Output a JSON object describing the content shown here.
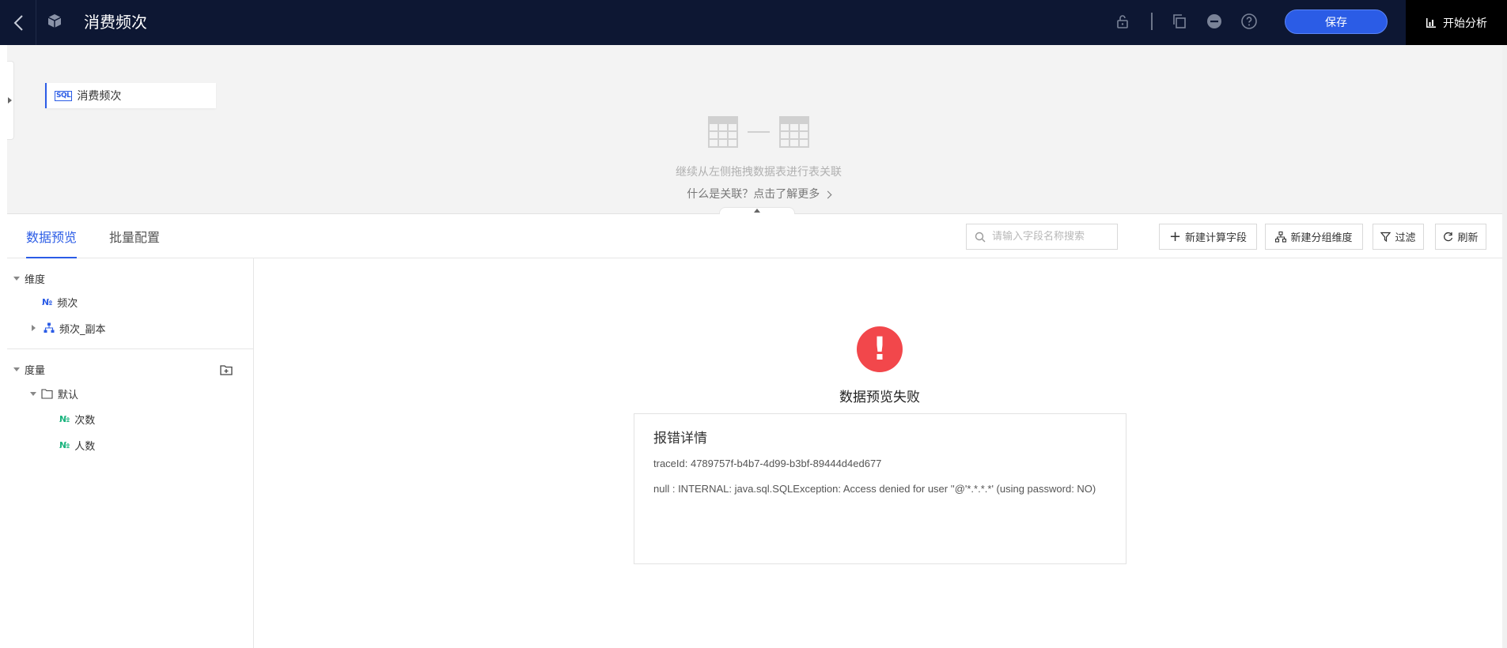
{
  "header": {
    "title": "消费频次",
    "save_label": "保存",
    "start_label": "开始分析",
    "icons": [
      "back-icon",
      "cube-icon",
      "lock-icon",
      "copy-icon",
      "minus-circle-icon",
      "help-icon",
      "chart-icon"
    ]
  },
  "canvas": {
    "table_node": {
      "badge": "SQL",
      "label": "消费频次"
    },
    "join_hint": "继续从左侧拖拽数据表进行表关联",
    "join_more": "什么是关联？点击了解更多"
  },
  "toolbar": {
    "tabs": [
      {
        "label": "数据预览",
        "active": true
      },
      {
        "label": "批量配置",
        "active": false
      }
    ],
    "search_placeholder": "请输入字段名称搜索",
    "buttons": {
      "new_calc": "新建计算字段",
      "new_group": "新建分组维度",
      "filter": "过滤",
      "refresh": "刷新"
    }
  },
  "tree": {
    "dimensions": {
      "label": "维度",
      "items": [
        {
          "icon": "№",
          "label": "频次"
        },
        {
          "icon": "hierarchy",
          "label": "频次_副本"
        }
      ]
    },
    "measures": {
      "label": "度量",
      "folder": "默认",
      "items": [
        {
          "icon": "№",
          "label": "次数"
        },
        {
          "icon": "№",
          "label": "人数"
        }
      ]
    }
  },
  "error": {
    "icon_text": "!",
    "title": "数据预览失败",
    "card_title": "报错详情",
    "trace": "traceId: 4789757f-b4b7-4d99-b3bf-89444d4ed677",
    "message": "null : INTERNAL: java.sql.SQLException: Access denied for user ''@'*.*.*.*' (using password: NO)"
  },
  "colors": {
    "header_bg": "#0d1733",
    "accent": "#2b5ce6",
    "error_red": "#f2474b",
    "measure_green": "#19b37d"
  }
}
